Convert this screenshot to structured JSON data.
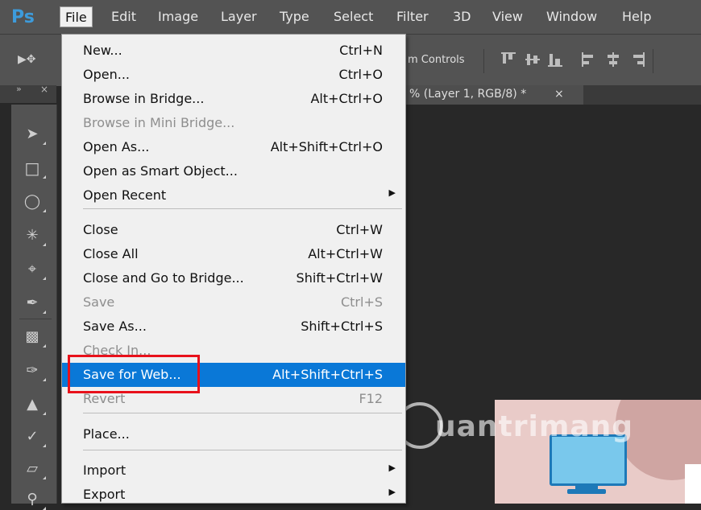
{
  "app": {
    "logo": "Ps"
  },
  "menubar": {
    "items": [
      {
        "label": "File"
      },
      {
        "label": "Edit"
      },
      {
        "label": "Image"
      },
      {
        "label": "Layer"
      },
      {
        "label": "Type"
      },
      {
        "label": "Select"
      },
      {
        "label": "Filter"
      },
      {
        "label": "3D"
      },
      {
        "label": "View"
      },
      {
        "label": "Window"
      },
      {
        "label": "Help"
      }
    ],
    "active": "File"
  },
  "options_bar": {
    "controls_label": "m Controls"
  },
  "tools_panel": {
    "header_arrows": "»",
    "header_close": "×",
    "tools": [
      "move-icon",
      "marquee-icon",
      "lasso-icon",
      "magic-wand-icon",
      "crop-icon",
      "eyedropper-icon",
      "healing-brush-icon",
      "brush-icon",
      "clone-stamp-icon",
      "history-brush-icon",
      "eraser-icon",
      "paint-bucket-icon"
    ]
  },
  "document": {
    "tab_title": "% (Layer 1, RGB/8) *",
    "tab_close": "×"
  },
  "watermark": {
    "text": "uantrimang"
  },
  "file_menu": {
    "items": [
      {
        "label": "New...",
        "shortcut": "Ctrl+N"
      },
      {
        "label": "Open...",
        "shortcut": "Ctrl+O"
      },
      {
        "label": "Browse in Bridge...",
        "shortcut": "Alt+Ctrl+O"
      },
      {
        "label": "Browse in Mini Bridge...",
        "shortcut": ""
      },
      {
        "label": "Open As...",
        "shortcut": "Alt+Shift+Ctrl+O"
      },
      {
        "label": "Open as Smart Object...",
        "shortcut": ""
      },
      {
        "label": "Open Recent",
        "shortcut": "",
        "submenu": "▶"
      },
      {
        "label": "Close",
        "shortcut": "Ctrl+W"
      },
      {
        "label": "Close All",
        "shortcut": "Alt+Ctrl+W"
      },
      {
        "label": "Close and Go to Bridge...",
        "shortcut": "Shift+Ctrl+W"
      },
      {
        "label": "Save",
        "shortcut": "Ctrl+S"
      },
      {
        "label": "Save As...",
        "shortcut": "Shift+Ctrl+S"
      },
      {
        "label": "Check In...",
        "shortcut": ""
      },
      {
        "label": "Save for Web...",
        "shortcut": "Alt+Shift+Ctrl+S"
      },
      {
        "label": "Revert",
        "shortcut": "F12"
      },
      {
        "label": "Place...",
        "shortcut": ""
      },
      {
        "label": "Import",
        "shortcut": "",
        "submenu": "▶"
      },
      {
        "label": "Export",
        "shortcut": "",
        "submenu": "▶"
      }
    ],
    "highlighted": "Save for Web...",
    "disabled": [
      "Browse in Mini Bridge...",
      "Save",
      "Check In...",
      "Revert"
    ]
  },
  "colors": {
    "menu_highlight": "#0a78d7",
    "callout_box": "#e8111b",
    "logo": "#3d9bdb"
  }
}
